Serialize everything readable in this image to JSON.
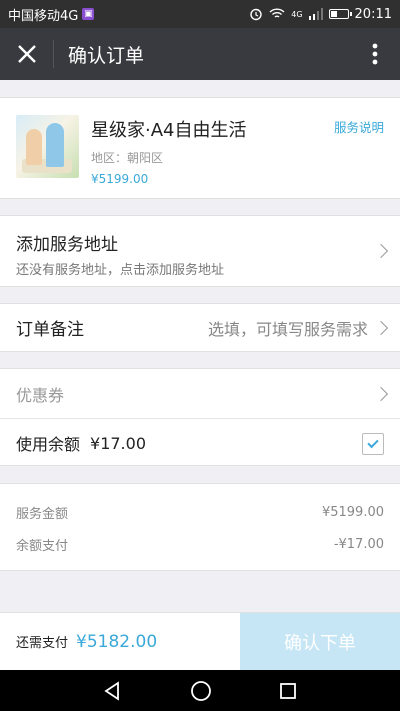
{
  "status": {
    "carrier": "中国移动4G",
    "sim_icon": "sim-icon",
    "network": "4G",
    "time": "20:11",
    "battery_level": 0.35
  },
  "nav": {
    "title": "确认订单",
    "close_icon": "close-icon",
    "more_icon": "more-vertical-icon"
  },
  "product": {
    "name": "星级家·A4自由生活",
    "region": "地区：朝阳区",
    "price": "¥5199.00",
    "service_info": "服务说明"
  },
  "address": {
    "title": "添加服务地址",
    "subtitle": "还没有服务地址，点击添加服务地址"
  },
  "remark": {
    "label": "订单备注",
    "placeholder": "选填，可填写服务需求"
  },
  "coupon": {
    "label": "优惠券"
  },
  "balance": {
    "label": "使用余额",
    "amount": "¥17.00",
    "checked": true
  },
  "summary": {
    "rows": [
      {
        "label": "服务金额",
        "value": "¥5199.00"
      },
      {
        "label": "余额支付",
        "value": "-¥17.00"
      }
    ]
  },
  "footer": {
    "label": "还需支付",
    "total": "¥5182.00",
    "confirm": "确认下单"
  },
  "colors": {
    "accent": "#3aa9d9",
    "navbar": "#393a3f",
    "confirm_disabled": "#c6e6f5"
  }
}
